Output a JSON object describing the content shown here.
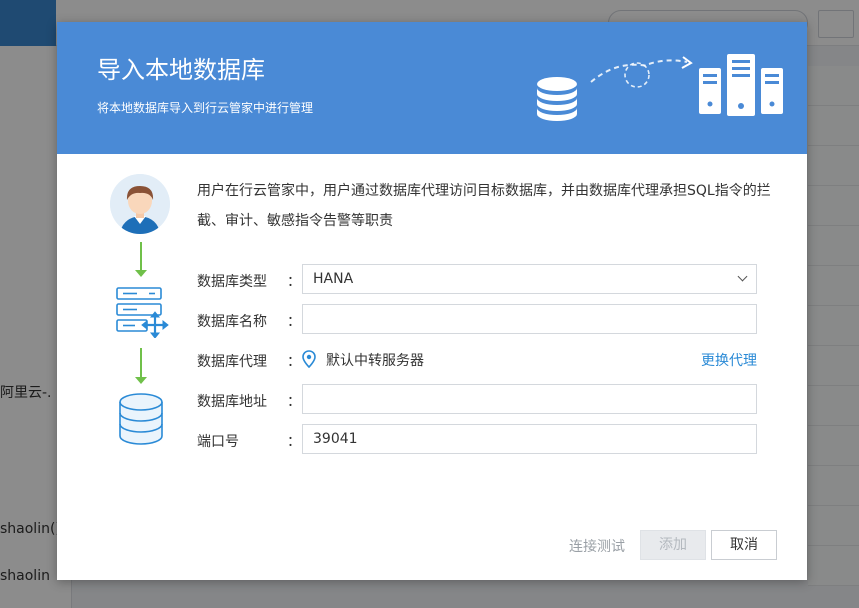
{
  "background": {
    "sidebar_texts": [
      "阿里云-.",
      "shaolin()",
      "shaolin"
    ]
  },
  "modal": {
    "title": "导入本地数据库",
    "subtitle": "将本地数据库导入到行云管家中进行管理",
    "description": "用户在行云管家中，用户通过数据库代理访问目标数据库，并由数据库代理承担SQL指令的拦截、审计、敏感指令告警等职责",
    "form": {
      "db_type": {
        "label": "数据库类型",
        "value": "HANA"
      },
      "db_name": {
        "label": "数据库名称",
        "value": ""
      },
      "db_proxy": {
        "label": "数据库代理",
        "value": "默认中转服务器",
        "action": "更换代理"
      },
      "db_address": {
        "label": "数据库地址",
        "value": ""
      },
      "port": {
        "label": "端口号",
        "value": "39041"
      },
      "colon": "："
    },
    "buttons": {
      "test": "连接测试",
      "add": "添加",
      "cancel": "取消"
    }
  },
  "colors": {
    "header_blue": "#4a8ad6",
    "link_blue": "#2a8ad6",
    "flow_green": "#70c04a"
  },
  "icons": [
    "user-avatar-icon",
    "proxy-server-icon",
    "database-icon",
    "location-pin-icon",
    "chevron-down-icon",
    "server-rack-icon"
  ]
}
